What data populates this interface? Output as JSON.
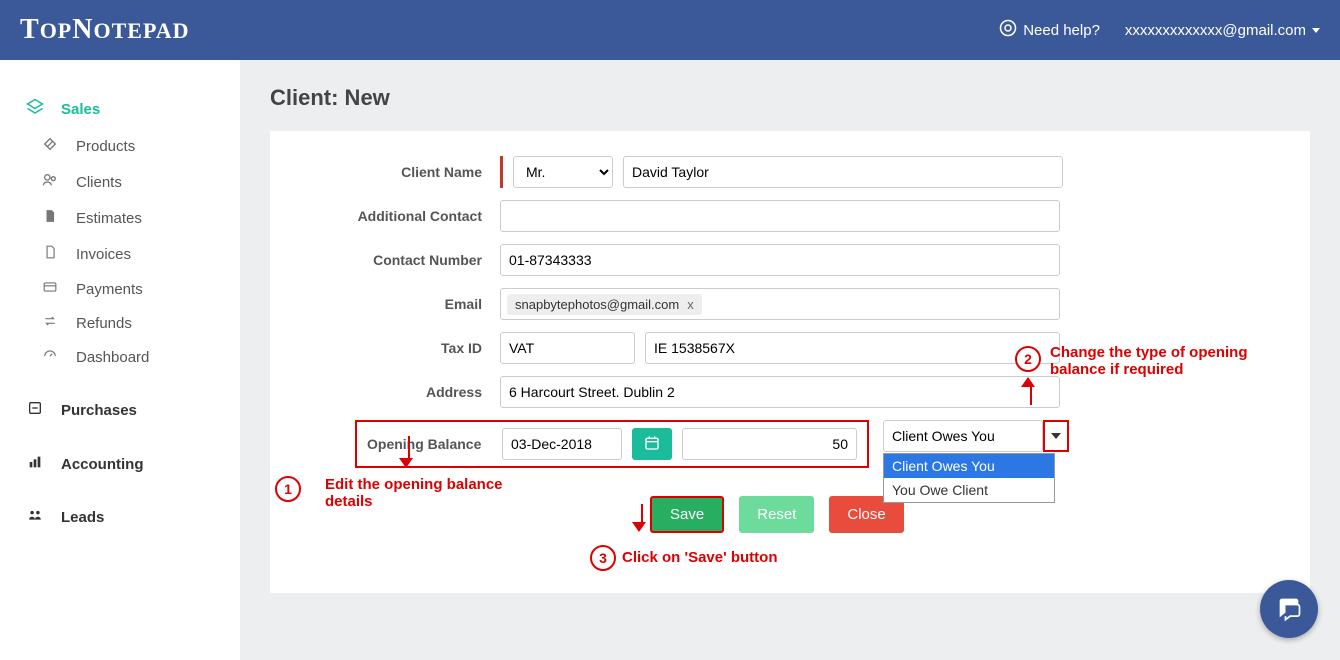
{
  "header": {
    "brand": "TopNotepad",
    "need_help": "Need help?",
    "user_email": "xxxxxxxxxxxxx@gmail.com"
  },
  "sidebar": {
    "items": [
      {
        "label": "Sales"
      },
      {
        "label": "Products"
      },
      {
        "label": "Clients"
      },
      {
        "label": "Estimates"
      },
      {
        "label": "Invoices"
      },
      {
        "label": "Payments"
      },
      {
        "label": "Refunds"
      },
      {
        "label": "Dashboard"
      },
      {
        "label": "Purchases"
      },
      {
        "label": "Accounting"
      },
      {
        "label": "Leads"
      }
    ]
  },
  "page": {
    "title": "Client: New"
  },
  "form": {
    "labels": {
      "client_name": "Client Name",
      "additional_contact": "Additional Contact",
      "contact_number": "Contact Number",
      "email": "Email",
      "tax_id": "Tax ID",
      "address": "Address",
      "opening_balance": "Opening Balance"
    },
    "salutation": "Mr.",
    "client_name": "David Taylor",
    "additional_contact": "",
    "contact_number": "01-87343333",
    "email_chip": "snapbytephotos@gmail.com",
    "tax_id_type": "VAT",
    "tax_id_value": "IE 1538567X",
    "address": "6 Harcourt Street. Dublin 2",
    "ob_date": "03-Dec-2018",
    "ob_amount": "50",
    "balance_type_selected": "Client Owes You",
    "balance_type_options": [
      "Client Owes You",
      "You Owe Client"
    ],
    "buttons": {
      "save": "Save",
      "reset": "Reset",
      "close": "Close"
    }
  },
  "annotations": {
    "a1": "Edit the opening balance details",
    "a2": "Change the type of opening balance if required",
    "a3": "Click on 'Save' button",
    "n1": "1",
    "n2": "2",
    "n3": "3"
  }
}
